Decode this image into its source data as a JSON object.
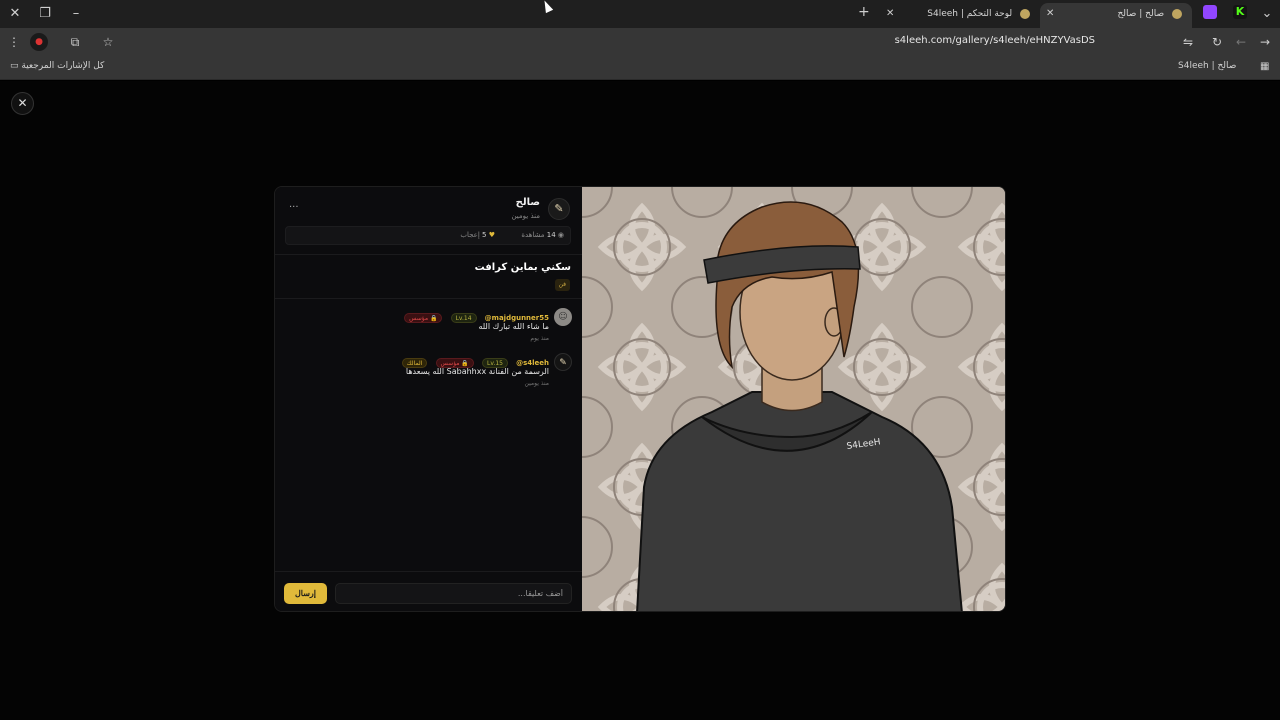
{
  "browser": {
    "tabs": [
      {
        "title": "صالح | صالح",
        "active": true
      },
      {
        "title": "لوحة التحكم | S4leeh",
        "active": false
      }
    ],
    "new_tab_label": "+",
    "url": "s4leeh.com/gallery/s4leeh/eHNZYVasDS",
    "bookmarks": {
      "all_bookmarks": "كل الإشارات المرجعية",
      "bookmark_1": "صالح | S4leeh"
    },
    "colors": {
      "chrome": "#1f1f1f",
      "toolbar": "#363636",
      "twitch": "#9146ff",
      "kick": "#53fc18"
    }
  },
  "post": {
    "author_name": "صالح",
    "author_time": "منذ يومين",
    "more_label": "...",
    "views_count": "14",
    "views_label": "مشاهدة",
    "likes_count": "5",
    "likes_label": "إعجاب",
    "title": "سكني بماين كرافت",
    "tag": "فن"
  },
  "comments": [
    {
      "user": "@majdgunner55",
      "level": "Lv.14",
      "badges": [
        "مؤسس"
      ],
      "text": "ما شاء الله تبارك الله",
      "time": "منذ يوم"
    },
    {
      "user": "@s4leeh",
      "level": "Lv.15",
      "badges": [
        "مؤسس",
        "المالك"
      ],
      "text": "الرسمة من الفنانة Sabahhxx الله يسعدها",
      "time": "منذ يومين"
    }
  ],
  "composer": {
    "placeholder": "أضف تعليقا...",
    "send_label": "إرسال"
  },
  "artwork": {
    "hoodie_text": "S4LeeH"
  },
  "theme": {
    "accent": "#e0b93a",
    "founder_red": "#e04848",
    "panel_bg": "#0c0c0e"
  }
}
